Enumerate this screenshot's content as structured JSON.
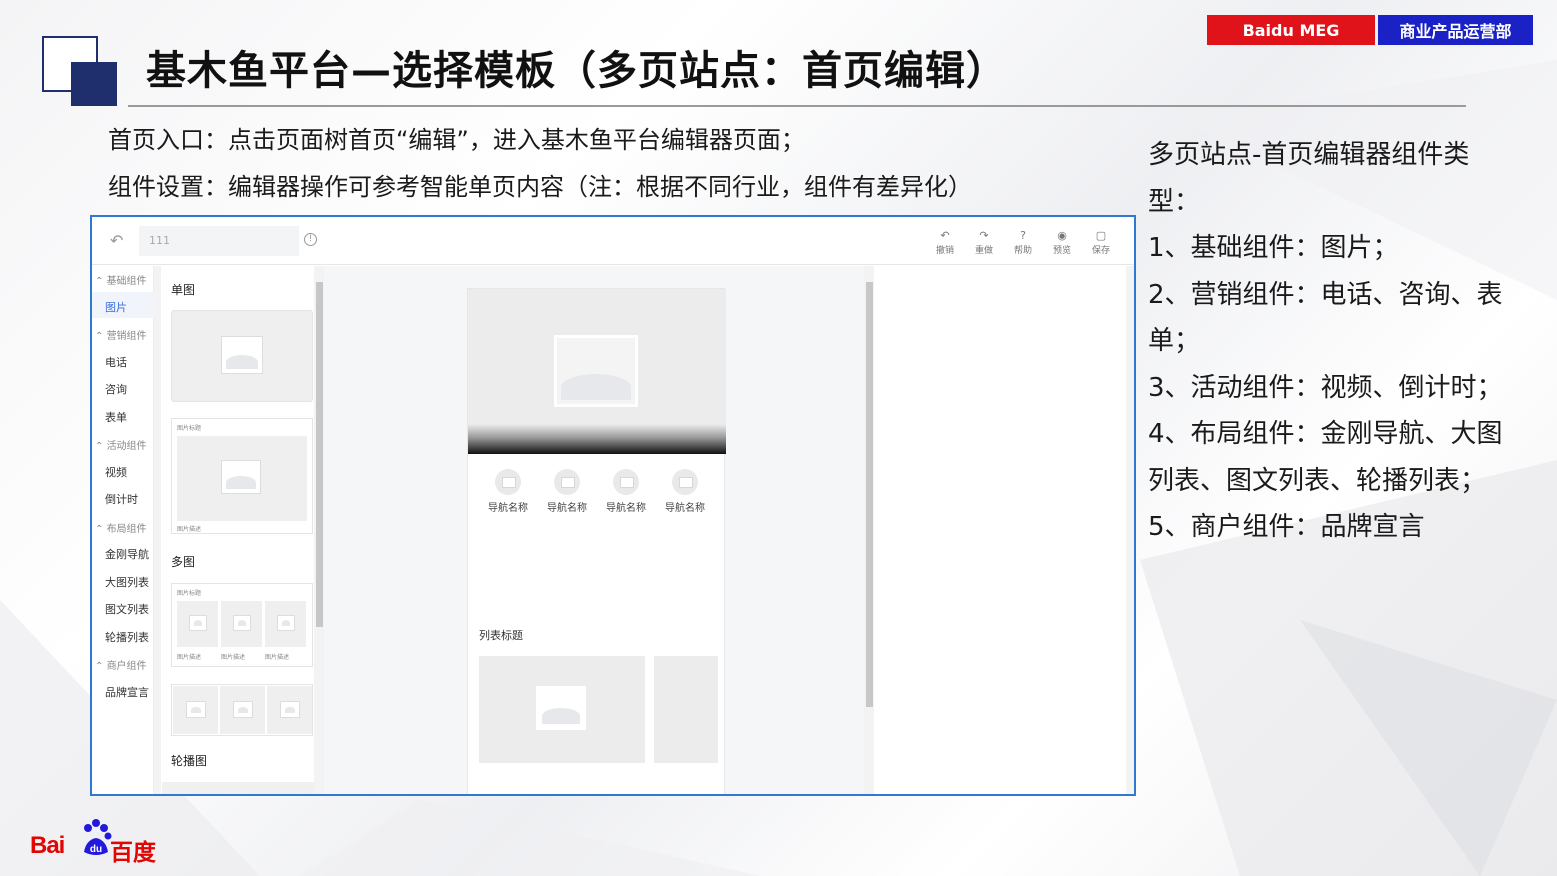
{
  "header": {
    "title": "基木鱼平台—选择模板（多页站点：首页编辑）",
    "tag_left": "Baidu MEG",
    "tag_right": "商业产品运营部"
  },
  "intro": {
    "line1": "首页入口：点击页面树首页“编辑”，进入基木鱼平台编辑器页面；",
    "line2": "组件设置：编辑器操作可参考智能单页内容（注：根据不同行业，组件有差异化）"
  },
  "right_panel": {
    "line1": "多页站点-首页编辑器组件类型：",
    "line2": "1、基础组件：图片；",
    "line3": "2、营销组件：电话、咨询、表单；",
    "line4": "3、活动组件：视频、倒计时；",
    "line5": "4、布局组件：金刚导航、大图列表、图文列表、轮播列表；",
    "line6": "5、商户组件：品牌宣言"
  },
  "editor": {
    "page_name": "111",
    "toolbar": [
      {
        "label": "撤销",
        "icon": "undo-icon",
        "glyph": "↶"
      },
      {
        "label": "重做",
        "icon": "redo-icon",
        "glyph": "↷"
      },
      {
        "label": "帮助",
        "icon": "help-icon",
        "glyph": "?"
      },
      {
        "label": "预览",
        "icon": "eye-icon",
        "glyph": "◉"
      },
      {
        "label": "保存",
        "icon": "save-icon",
        "glyph": "▢"
      }
    ],
    "sidebar": {
      "groups": [
        {
          "label": "基础组件",
          "items": [
            "图片"
          ]
        },
        {
          "label": "营销组件",
          "items": [
            "电话",
            "咨询",
            "表单"
          ]
        },
        {
          "label": "活动组件",
          "items": [
            "视频",
            "倒计时"
          ]
        },
        {
          "label": "布局组件",
          "items": [
            "金刚导航",
            "大图列表",
            "图文列表",
            "轮播列表"
          ]
        },
        {
          "label": "商户组件",
          "items": [
            "品牌宣言"
          ]
        }
      ]
    },
    "library": {
      "single_heading": "单图",
      "multi_heading": "多图",
      "carousel_heading": "轮播图",
      "caption_title": "图片标题",
      "caption_desc": "图片描述"
    },
    "canvas": {
      "nav_items": [
        "导航名称",
        "导航名称",
        "导航名称",
        "导航名称"
      ],
      "list_title": "列表标题"
    }
  },
  "logo": {
    "text": "Bai",
    "du": "du",
    "cn": "百度"
  }
}
